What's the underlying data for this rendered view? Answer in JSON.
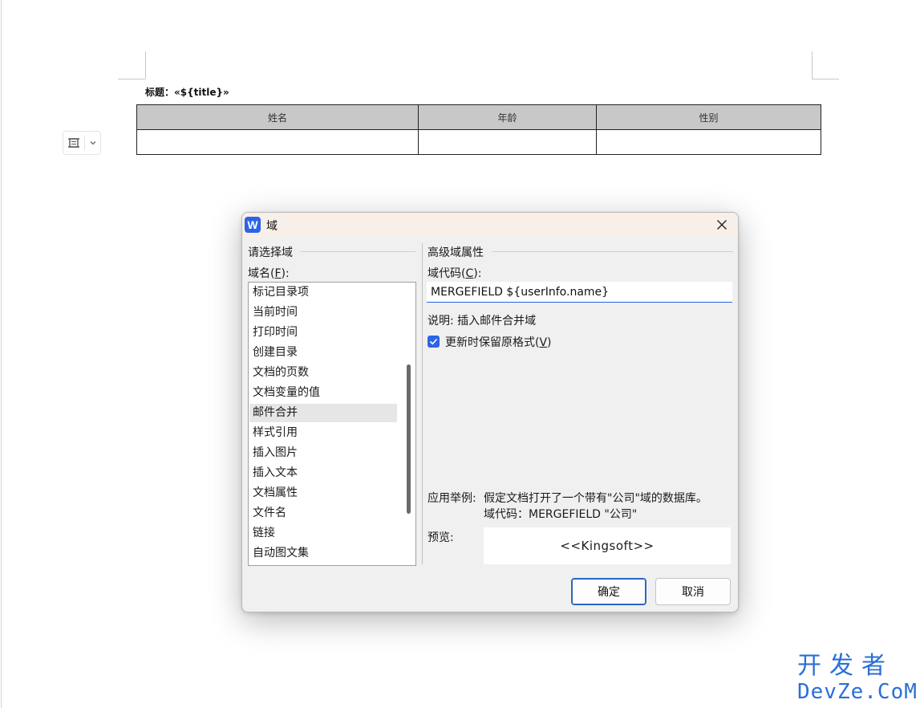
{
  "document": {
    "title_text": "标题：«${title}»",
    "table": {
      "headers": [
        "姓名",
        "年龄",
        "性别"
      ],
      "rows": [
        [
          "",
          "",
          ""
        ]
      ]
    }
  },
  "dialog": {
    "title": "域",
    "app_icon_letter": "W",
    "left_group_label": "请选择域",
    "field_names_label": "域名(",
    "field_names_accel": "F",
    "field_names_label_end": "):",
    "field_list": [
      "标记目录项",
      "当前时间",
      "打印时间",
      "创建目录",
      "文档的页数",
      "文档变量的值",
      "邮件合并",
      "样式引用",
      "插入图片",
      "插入文本",
      "文档属性",
      "文件名",
      "链接",
      "自动图文集"
    ],
    "selected_field": "邮件合并",
    "right_group_label": "高级域属性",
    "field_code_label": "域代码(",
    "field_code_accel": "C",
    "field_code_label_end": "):",
    "field_code_value": "MERGEFIELD ${userInfo.name}",
    "description": "说明: 插入邮件合并域",
    "preserve_format_label": "更新时保留原格式(",
    "preserve_format_accel": "V",
    "preserve_format_label_end": ")",
    "preserve_format_checked": true,
    "example_label": "应用举例:",
    "example_line1": "假定文档打开了一个带有\"公司\"域的数据库。",
    "example_line2": "域代码：MERGEFIELD \"公司\"",
    "preview_label": "预览:",
    "preview_value": "<<Kingsoft>>",
    "ok_label": "确定",
    "cancel_label": "取消"
  },
  "watermark": {
    "line1": "开发者",
    "line2": "DevZe.CoM"
  },
  "colors": {
    "accent": "#2b64e6",
    "table_header_bg": "#c8c8c8",
    "titlebar_bg": "#f8efe9",
    "dialog_bg": "#f0f0f0",
    "watermark": "#2a6fd6"
  }
}
